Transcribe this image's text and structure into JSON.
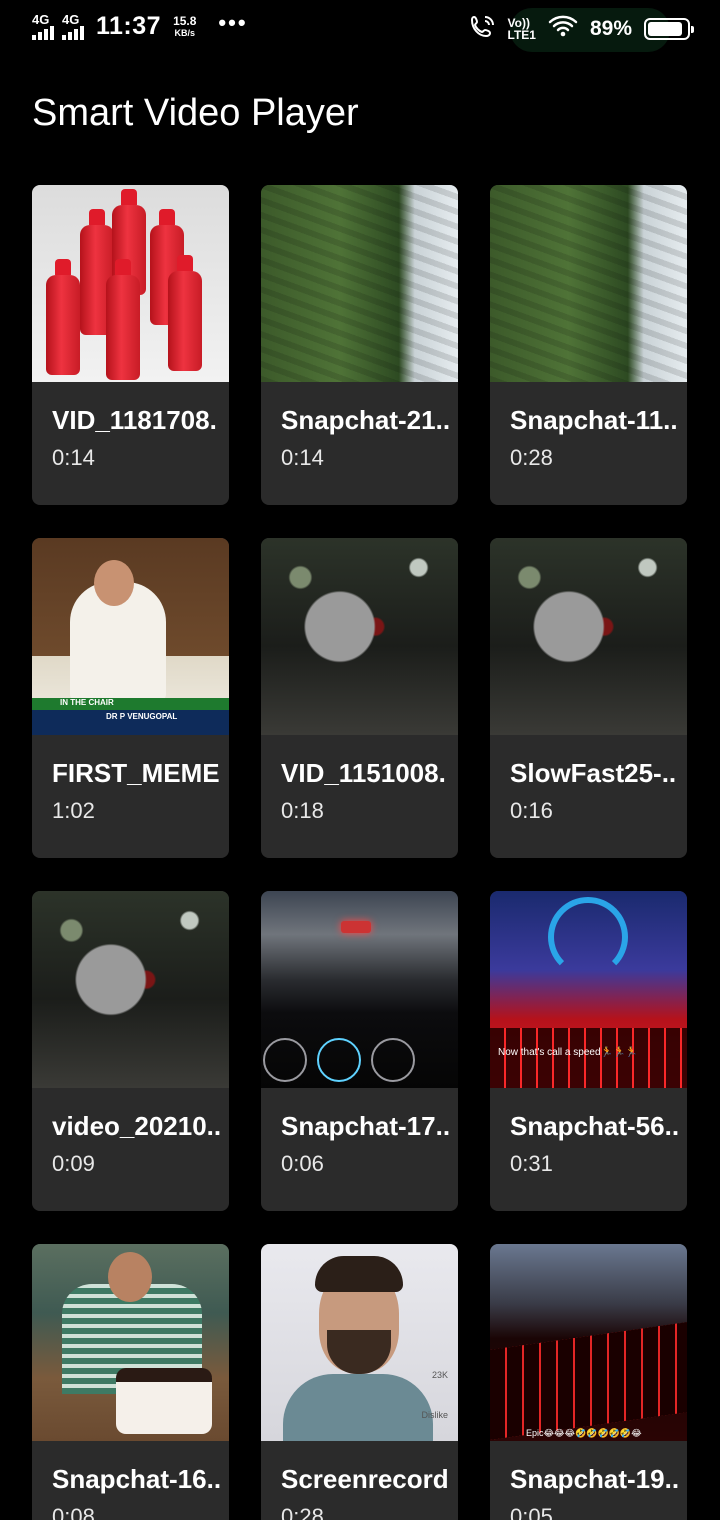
{
  "status_bar": {
    "network_1": "4G",
    "network_2": "4G",
    "time": "11:37",
    "speed_value": "15.8",
    "speed_unit": "KB/s",
    "more": "•••",
    "volte_top": "Vo))",
    "volte_bottom": "LTE1",
    "battery_percent": "89%",
    "battery_level": 0.89
  },
  "app": {
    "title": "Smart Video Player"
  },
  "videos": [
    {
      "title": "VID_1181708.",
      "duration": "0:14",
      "thumb": "soda-bottles"
    },
    {
      "title": "Snapchat-21..",
      "duration": "0:14",
      "thumb": "landscape"
    },
    {
      "title": "Snapchat-11..",
      "duration": "0:28",
      "thumb": "landscape"
    },
    {
      "title": "FIRST_MEME.",
      "duration": "1:02",
      "thumb": "parliament",
      "overlay_1": "IN THE CHAIR",
      "overlay_2": "DR P VENUGOPAL"
    },
    {
      "title": "VID_1151008.",
      "duration": "0:18",
      "thumb": "rainy-window"
    },
    {
      "title": "SlowFast25-..",
      "duration": "0:16",
      "thumb": "rainy-window"
    },
    {
      "title": "video_20210..",
      "duration": "0:09",
      "thumb": "rainy-window"
    },
    {
      "title": "Snapchat-17..",
      "duration": "0:06",
      "thumb": "car-dashboard"
    },
    {
      "title": "Snapchat-56..",
      "duration": "0:31",
      "thumb": "speedtest-laptop",
      "caption": "Now that's call a speed🏃🏃🏃"
    },
    {
      "title": "Snapchat-16..",
      "duration": "0:08",
      "thumb": "cake"
    },
    {
      "title": "Screenrecord.",
      "duration": "0:28",
      "thumb": "selfie-video",
      "side_1": "23K",
      "side_2": "Dislike"
    },
    {
      "title": "Snapchat-19..",
      "duration": "0:05",
      "thumb": "laptop-keyboard",
      "caption": "Epic😂😂😂🤣🤣🤣🤣🤣😂"
    }
  ],
  "colors": {
    "background": "#000000",
    "card": "#2b2b2b",
    "text": "#ffffff"
  }
}
